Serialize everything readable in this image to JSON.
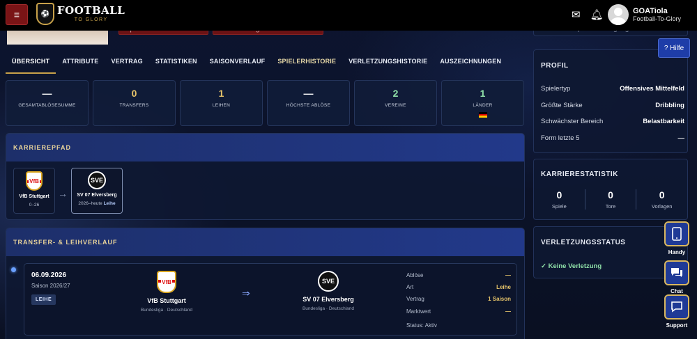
{
  "header": {
    "logo_main": "FOOTBALL",
    "logo_sub": "TO GLORY",
    "user_name": "GOATiola",
    "user_sub": "Football-To-Glory"
  },
  "peek": {
    "watch_btn": "Spieler beobachten",
    "offer_btn": "Transferangebot machen",
    "right_text": "Dauer der Spielberechtigung"
  },
  "tabs": [
    "ÜBERSICHT",
    "ATTRIBUTE",
    "VERTRAG",
    "STATISTIKEN",
    "SAISONVERLAUF",
    "SPIELERHISTORIE",
    "VERLETZUNGSHISTORIE",
    "AUSZEICHNUNGEN"
  ],
  "stats": [
    {
      "value": "—",
      "label": "GESAMTABLÖSESUMME"
    },
    {
      "value": "0",
      "label": "TRANSFERS"
    },
    {
      "value": "1",
      "label": "LEIHEN"
    },
    {
      "value": "—",
      "label": "HÖCHSTE ABLÖSE"
    },
    {
      "value": "2",
      "label": "VEREINE"
    },
    {
      "value": "1",
      "label": "LÄNDER"
    }
  ],
  "career_path": {
    "title": "KARRIEREPFAD",
    "clubs": [
      {
        "name": "VfB Stuttgart",
        "years": "0–26",
        "crest": "VfB",
        "tag": ""
      },
      {
        "name": "SV 07 Elversberg",
        "years": "2026–heute",
        "crest": "SVE",
        "tag": "Leihe"
      }
    ]
  },
  "transfer": {
    "title": "TRANSFER- & LEIHVERLAUF",
    "date": "06.09.2026",
    "season": "Saison 2026/27",
    "badge": "LEIHE",
    "from_club": "VfB Stuttgart",
    "from_league": "Bundesliga · Deutschland",
    "to_club": "SV 07 Elversberg",
    "to_league": "Bundesliga · Deutschland",
    "details": [
      {
        "k": "Ablöse",
        "v": "—"
      },
      {
        "k": "Art",
        "v": "Leihe"
      },
      {
        "k": "Vertrag",
        "v": "1 Saison"
      },
      {
        "k": "Marktwert",
        "v": "—"
      }
    ],
    "status": "Status: Aktiv"
  },
  "profile": {
    "title": "PROFIL",
    "rows": [
      {
        "k": "Spielertyp",
        "v": "Offensives Mittelfeld"
      },
      {
        "k": "Größte Stärke",
        "v": "Dribbling"
      },
      {
        "k": "Schwächster Bereich",
        "v": "Belastbarkeit"
      },
      {
        "k": "Form letzte 5",
        "v": "—"
      }
    ]
  },
  "career_stats": {
    "title": "KARRIERESTATISTIK",
    "items": [
      {
        "n": "0",
        "l": "Spiele"
      },
      {
        "n": "0",
        "l": "Tore"
      },
      {
        "n": "0",
        "l": "Vorlagen"
      }
    ]
  },
  "injury": {
    "title": "VERLETZUNGSSTATUS",
    "status": "✓ Keine Verletzung"
  },
  "help": "? Hilfe",
  "floating": [
    {
      "label": "Handy",
      "icon": "phone-icon"
    },
    {
      "label": "Chat",
      "icon": "chat-icon"
    },
    {
      "label": "Support",
      "icon": "support-icon"
    }
  ],
  "colors": {
    "accent_gold": "#e5c36a",
    "panel_header": "#22398a",
    "success_green": "#8fe0a8"
  }
}
